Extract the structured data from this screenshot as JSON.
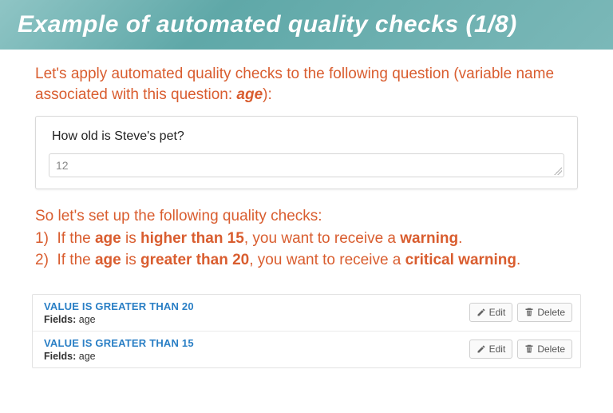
{
  "header": {
    "title": "Example of automated quality checks (1/8)"
  },
  "intro": {
    "line": "Let's apply automated quality checks to the following question (variable name associated with this question: ",
    "var": "age",
    "tail": "):"
  },
  "question": {
    "text": "How old is Steve's pet?",
    "value": "12"
  },
  "rules": {
    "lead": "So let's set up the following quality checks:",
    "r1_pre": "1)  If the ",
    "r1_age": "age",
    "r1_mid": " is ",
    "r1_cond": "higher than 15",
    "r1_after": ", you want to receive a ",
    "r1_warn": "warning",
    "r1_end": ".",
    "r2_pre": "2)  If the ",
    "r2_age": "age",
    "r2_mid": " is ",
    "r2_cond": "greater than 20",
    "r2_after": ", you want to receive a ",
    "r2_warn": "critical warning",
    "r2_end": "."
  },
  "checks": [
    {
      "title": "VALUE IS GREATER THAN 20",
      "fields_label": "Fields:",
      "fields": "age",
      "edit": "Edit",
      "delete": "Delete"
    },
    {
      "title": "VALUE IS GREATER THAN 15",
      "fields_label": "Fields:",
      "fields": "age",
      "edit": "Edit",
      "delete": "Delete"
    }
  ]
}
